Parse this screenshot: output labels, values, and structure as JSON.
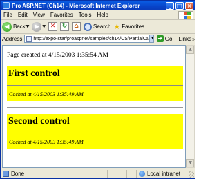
{
  "window": {
    "title": "Pro ASP.NET (Ch14) - Microsoft Internet Explorer",
    "controls": {
      "minimize": "_",
      "maximize": "□",
      "close": "×"
    }
  },
  "menubar": {
    "items": [
      "File",
      "Edit",
      "View",
      "Favorites",
      "Tools",
      "Help"
    ]
  },
  "toolbar": {
    "back_label": "Back",
    "search_label": "Search",
    "favorites_label": "Favorites",
    "icons": [
      "back-icon",
      "forward-icon",
      "stop-icon",
      "refresh-icon",
      "home-icon",
      "search-icon",
      "favorites-icon"
    ]
  },
  "address": {
    "label": "Address",
    "url": "http://expo-star/proaspnet/samples/ch14/CS/PartialCa",
    "go_label": "Go",
    "links_label": "Links"
  },
  "page": {
    "created_text": "Page created at 4/15/2003 1:35:54 AM",
    "controls": [
      {
        "heading": "First control",
        "cached_text": "Cached at 4/15/2003 1:35:49 AM"
      },
      {
        "heading": "Second control",
        "cached_text": "Cached at 4/15/2003 1:35:49 AM"
      }
    ],
    "highlight_color": "#ffff00"
  },
  "statusbar": {
    "status": "Done",
    "zone": "Local intranet"
  }
}
